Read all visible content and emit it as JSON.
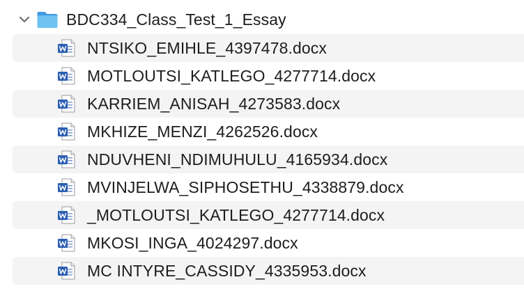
{
  "folder": {
    "name": "BDC334_Class_Test_1_Essay",
    "expanded": true,
    "icon": "folder-icon",
    "disclosure_icon": "chevron-down-icon",
    "color": "#5ab4ea"
  },
  "files": [
    {
      "name": "NTSIKO_EMIHLE_4397478.docx",
      "icon": "word-doc-icon"
    },
    {
      "name": "MOTLOUTSI_KATLEGO_4277714.docx",
      "icon": "word-doc-icon"
    },
    {
      "name": "KARRIEM_ANISAH_4273583.docx",
      "icon": "word-doc-icon"
    },
    {
      "name": "MKHIZE_MENZI_4262526.docx",
      "icon": "word-doc-icon"
    },
    {
      "name": "NDUVHENI_NDIMUHULU_4165934.docx",
      "icon": "word-doc-icon"
    },
    {
      "name": "MVINJELWA_SIPHOSETHU_4338879.docx",
      "icon": "word-doc-icon"
    },
    {
      "name": "_MOTLOUTSI_KATLEGO_4277714.docx",
      "icon": "word-doc-icon"
    },
    {
      "name": "MKOSI_INGA_4024297.docx",
      "icon": "word-doc-icon"
    },
    {
      "name": "MC INTYRE_CASSIDY_4335953.docx",
      "icon": "word-doc-icon"
    }
  ],
  "colors": {
    "stripe": "#f4f4f5",
    "word_blue": "#2b5fb3",
    "text": "#1d1d1f"
  }
}
